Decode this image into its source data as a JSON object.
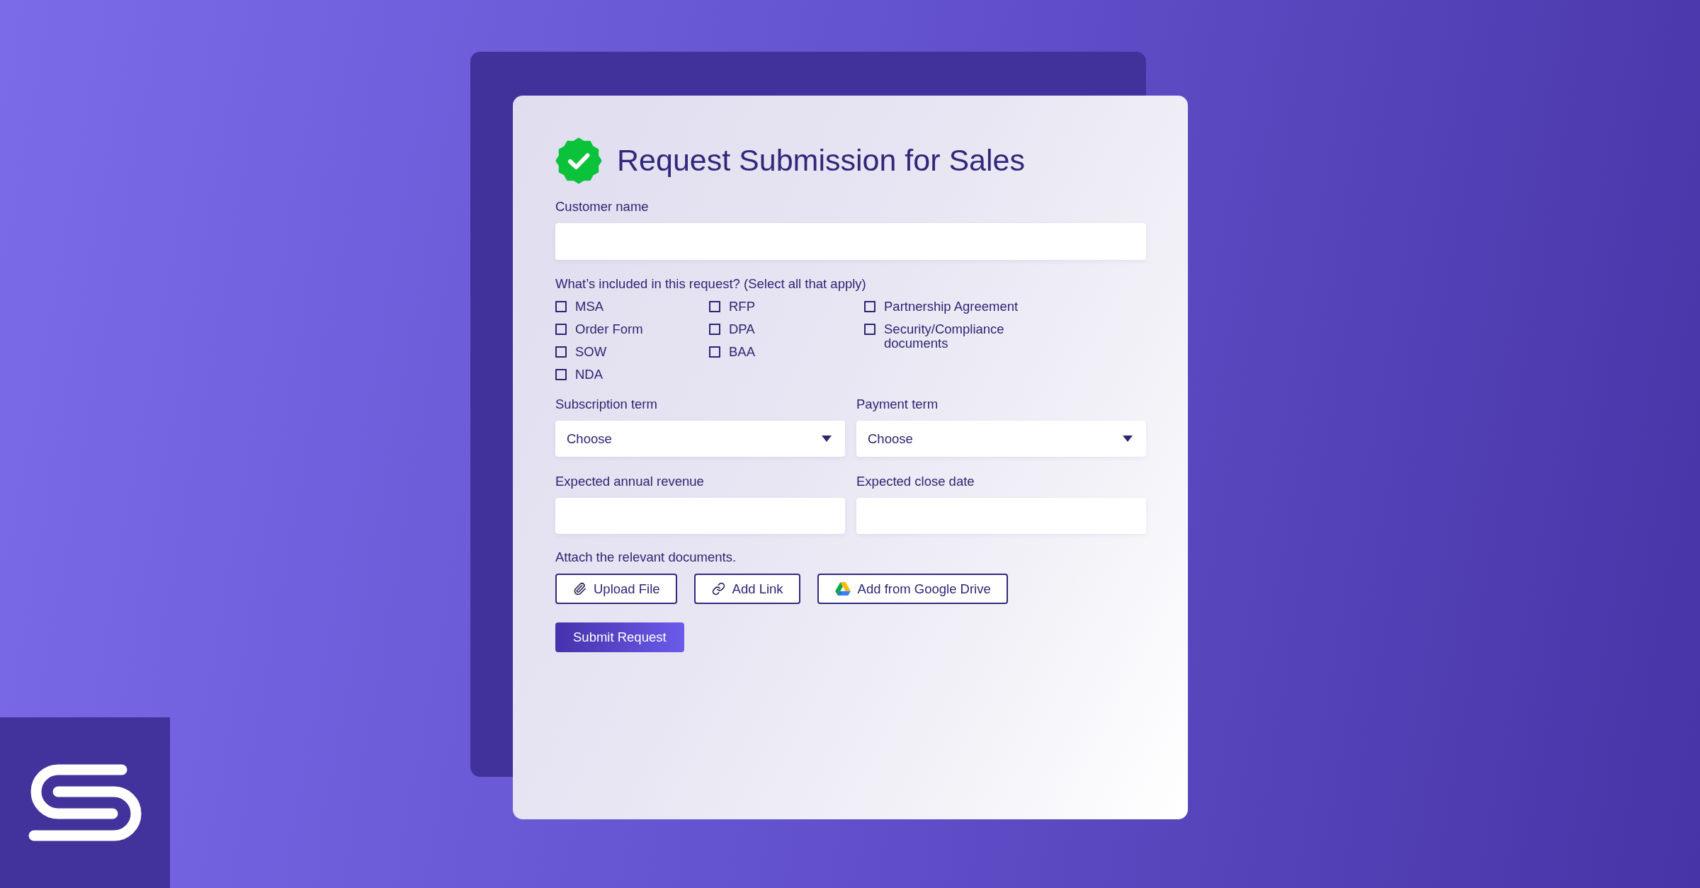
{
  "form": {
    "title": "Request Submission for Sales",
    "customer_name": {
      "label": "Customer name"
    },
    "included": {
      "label": "What’s included in this request? (Select all that apply)",
      "columns": [
        {
          "options": [
            {
              "label": "MSA",
              "checked": false
            },
            {
              "label": "Order Form",
              "checked": false
            },
            {
              "label": "SOW",
              "checked": false
            },
            {
              "label": "NDA",
              "checked": false
            }
          ]
        },
        {
          "options": [
            {
              "label": "RFP",
              "checked": false
            },
            {
              "label": "DPA",
              "checked": false
            },
            {
              "label": "BAA",
              "checked": false
            }
          ]
        },
        {
          "options": [
            {
              "label": "Partnership Agreement",
              "checked": false
            },
            {
              "label": "Security/Compliance documents",
              "checked": false
            }
          ]
        }
      ]
    },
    "fields": [
      {
        "kind": "select",
        "label": "Subscription term",
        "placeholder": "Choose"
      },
      {
        "kind": "select",
        "label": "Payment term",
        "placeholder": "Choose"
      },
      {
        "kind": "text",
        "label": "Expected annual revenue"
      },
      {
        "kind": "text",
        "label": "Expected close date"
      }
    ],
    "attachments": {
      "label": "Attach the relevant documents.",
      "buttons": [
        {
          "kind": "file",
          "label": "Upload File"
        },
        {
          "kind": "link",
          "label": "Add Link"
        },
        {
          "kind": "drive",
          "label": "Add from Google Drive"
        }
      ]
    },
    "submit": {
      "label": "Submit Request"
    }
  }
}
